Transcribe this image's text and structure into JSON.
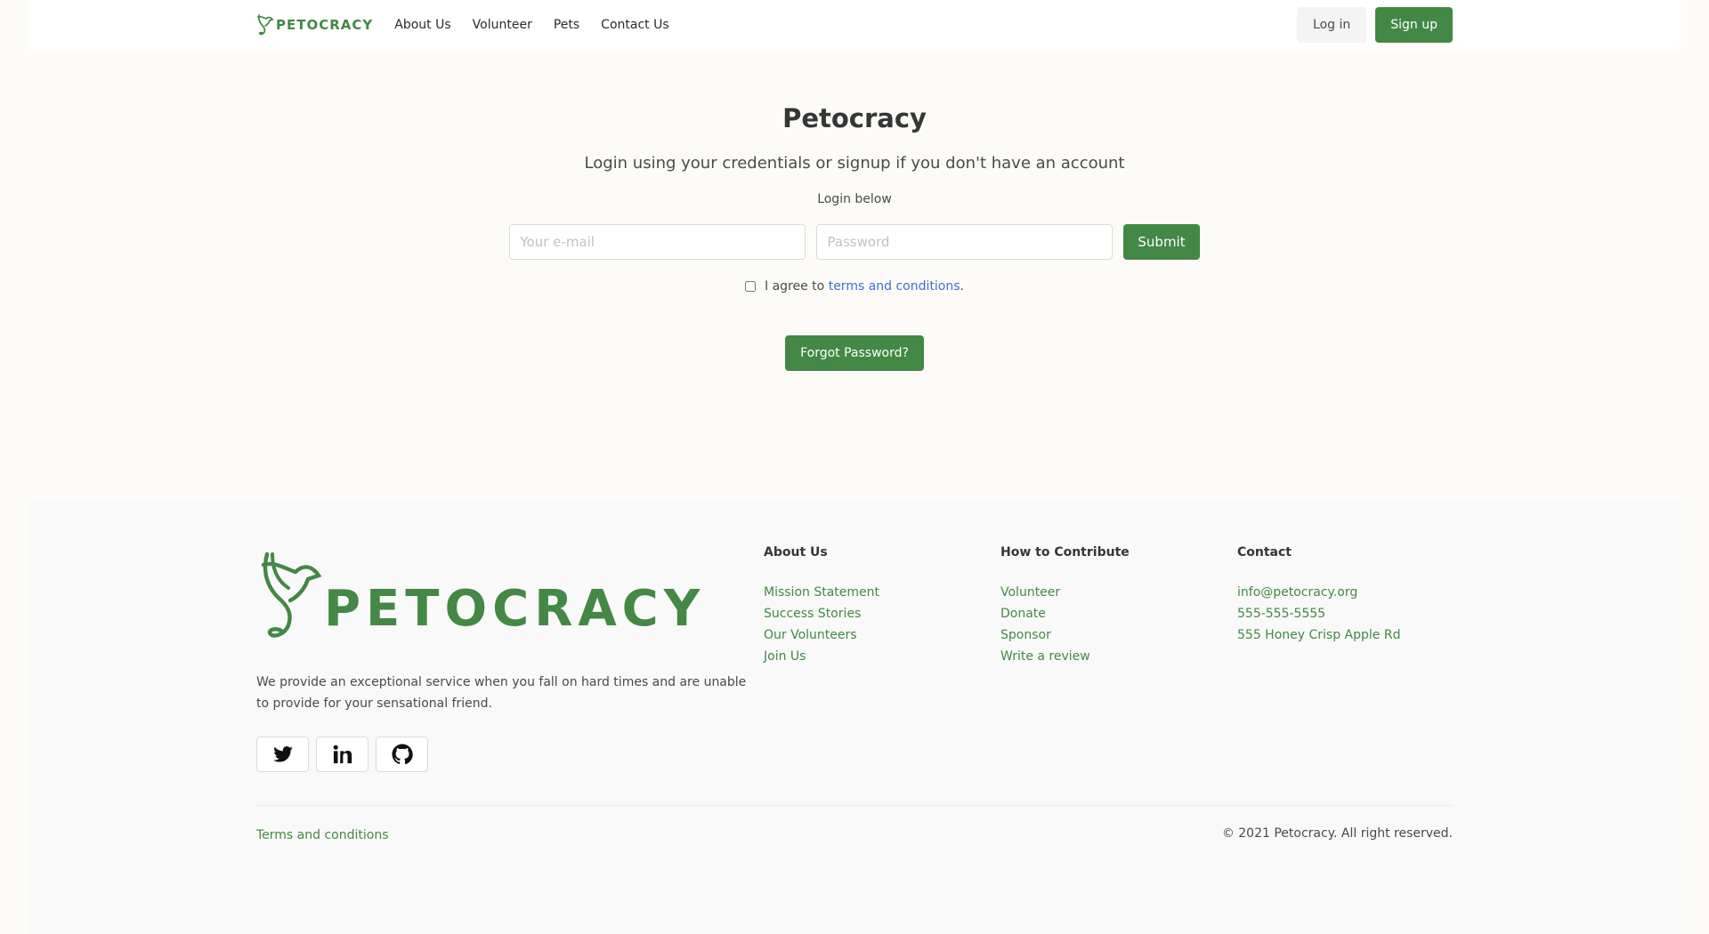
{
  "nav": {
    "logo_text": "PETOCRACY",
    "links": [
      "About Us",
      "Volunteer",
      "Pets",
      "Contact Us"
    ],
    "login_label": "Log in",
    "signup_label": "Sign up"
  },
  "main": {
    "title": "Petocracy",
    "subtitle": "Login using your credentials or signup if you don't have an account",
    "login_below": "Login below",
    "email_placeholder": "Your e-mail",
    "email_value": "",
    "password_placeholder": "Password",
    "password_value": "",
    "submit_label": "Submit",
    "agree_prefix": "I agree to ",
    "agree_link": "terms and conditions",
    "agree_suffix": ".",
    "agree_checked": false,
    "forgot_label": "Forgot Password?"
  },
  "footer": {
    "logo_text": "PETOCRACY",
    "description": "We provide an exceptional service when you fall on hard times and are unable to provide for your sensational friend.",
    "socials": [
      "twitter-icon",
      "linkedin-icon",
      "github-icon"
    ],
    "columns": [
      {
        "title": "About Us",
        "links": [
          "Mission Statement",
          "Success Stories",
          "Our Volunteers",
          "Join Us"
        ]
      },
      {
        "title": "How to Contribute",
        "links": [
          "Volunteer",
          "Donate",
          "Sponsor",
          "Write a review"
        ]
      },
      {
        "title": "Contact",
        "links": [
          "info@petocracy.org",
          "555-555-5555",
          "555 Honey Crisp Apple Rd"
        ]
      }
    ],
    "terms_label": "Terms and conditions",
    "copyright": "© 2021 Petocracy. All right reserved."
  },
  "colors": {
    "brand_green": "#438844",
    "link_blue": "#3e6fcf",
    "page_bg": "#fcfbf7",
    "footer_bg": "#f9f9f9"
  }
}
